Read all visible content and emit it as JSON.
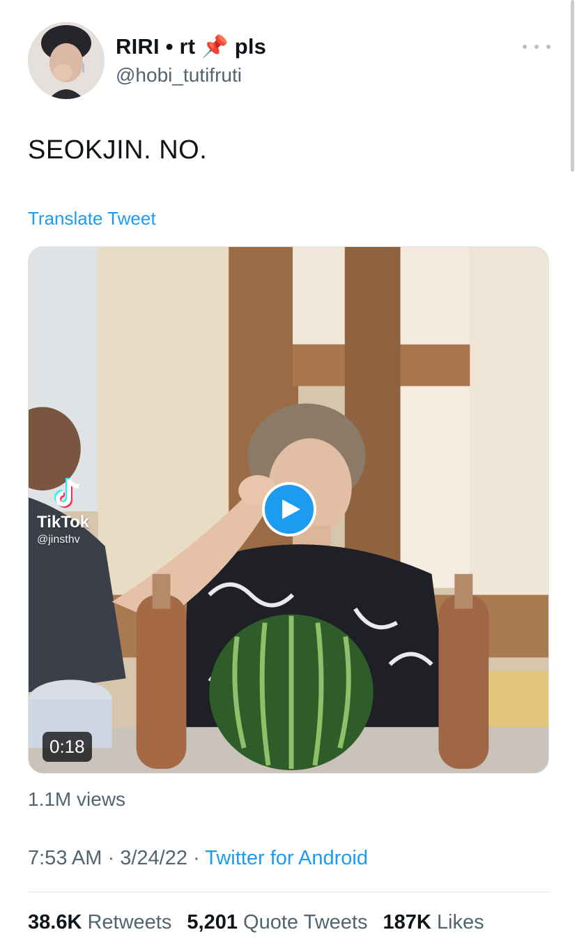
{
  "tweet": {
    "author": {
      "display_name": "RIRI • rt 📌 pls",
      "handle": "@hobi_tutifruti"
    },
    "text": "SEOKJIN. NO.",
    "translate_label": "Translate Tweet",
    "media": {
      "type": "video",
      "duration": "0:18",
      "watermark_brand": "TikTok",
      "watermark_user": "@jinsthv"
    },
    "views": "1.1M views",
    "time": "7:53 AM",
    "date": "3/24/22",
    "separator": "·",
    "source": "Twitter for Android",
    "stats": {
      "retweets_count": "38.6K",
      "retweets_label": "Retweets",
      "quotes_count": "5,201",
      "quotes_label": "Quote Tweets",
      "likes_count": "187K",
      "likes_label": "Likes"
    }
  },
  "colors": {
    "link": "#1d9bf0",
    "secondary_text": "#536471",
    "primary_text": "#0f1419"
  }
}
